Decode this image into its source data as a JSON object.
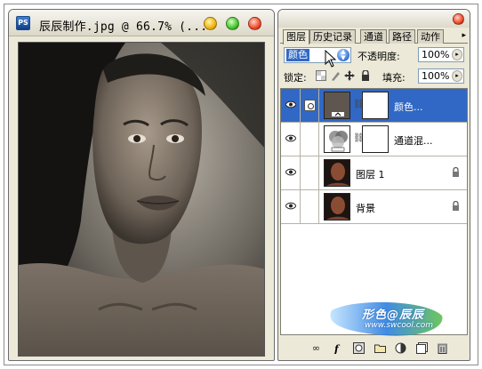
{
  "document_window": {
    "title": "辰辰制作.jpg @ 66.7% (...",
    "app_icon_text": "PS",
    "controls": [
      "minimize",
      "maximize",
      "close"
    ]
  },
  "layers_panel": {
    "tabs": [
      {
        "label": "图层",
        "active": true
      },
      {
        "label": "历史记录",
        "active": false
      },
      {
        "label": "通道",
        "active": false
      },
      {
        "label": "路径",
        "active": false
      },
      {
        "label": "动作",
        "active": false
      }
    ],
    "tab_menu_glyph": "▸",
    "blend_mode": {
      "value": "颜色"
    },
    "opacity": {
      "label": "不透明度:",
      "value": "100%"
    },
    "lock": {
      "label": "锁定:"
    },
    "fill": {
      "label": "填充:",
      "value": "100%"
    },
    "layers": [
      {
        "name": "颜色...",
        "selected": true,
        "visible": true,
        "type": "solid-color-fill",
        "has_mask": true,
        "locked": false
      },
      {
        "name": "通道混...",
        "selected": false,
        "visible": true,
        "type": "channel-mixer-adjustment",
        "has_mask": true,
        "locked": false
      },
      {
        "name": "图层 1",
        "selected": false,
        "visible": true,
        "type": "pixel",
        "has_mask": false,
        "locked": true
      },
      {
        "name": "背景",
        "selected": false,
        "visible": true,
        "type": "background",
        "has_mask": false,
        "locked": true
      }
    ],
    "bottom_icons": [
      "link-layers-icon",
      "layer-style-icon",
      "layer-mask-icon",
      "new-group-icon",
      "new-adjustment-layer-icon",
      "new-layer-icon",
      "trash-icon"
    ]
  },
  "watermark": {
    "line1": "形色@辰辰",
    "line2": "www.swcool.com"
  },
  "colors": {
    "selection_blue": "#3168c5",
    "panel_bg": "#ece9d8",
    "fill_layer_color": "#5f5650"
  }
}
